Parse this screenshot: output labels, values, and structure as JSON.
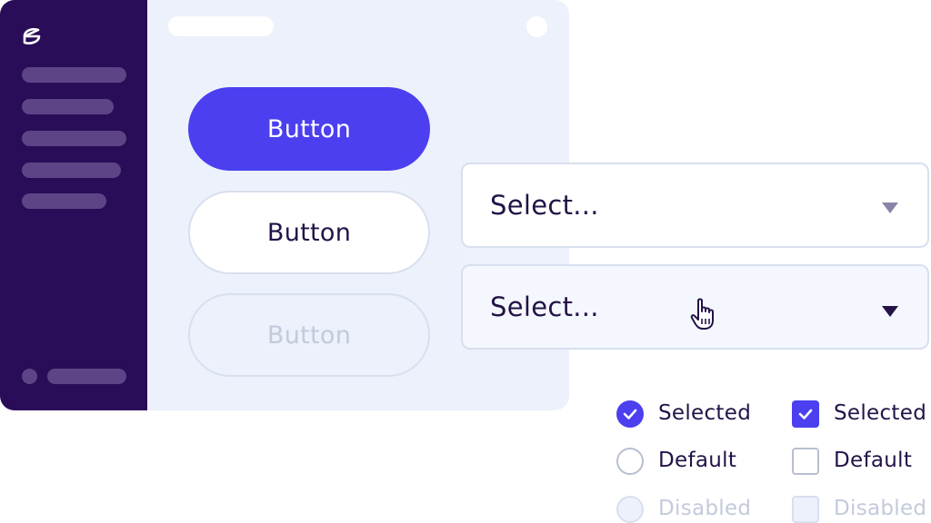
{
  "buttons": {
    "primary_label": "Button",
    "secondary_label": "Button",
    "disabled_label": "Button"
  },
  "selects": [
    {
      "placeholder": "Select...",
      "state": "default",
      "caret_icon": "chevron-down-icon"
    },
    {
      "placeholder": "Select...",
      "state": "hover",
      "caret_icon": "chevron-down-icon"
    }
  ],
  "radios": [
    {
      "label": "Selected",
      "state": "selected"
    },
    {
      "label": "Default",
      "state": "default"
    },
    {
      "label": "Disabled",
      "state": "disabled"
    }
  ],
  "checkboxes": [
    {
      "label": "Selected",
      "state": "selected"
    },
    {
      "label": "Default",
      "state": "default"
    },
    {
      "label": "Disabled",
      "state": "disabled"
    }
  ],
  "colors": {
    "accent": "#4b3ff0",
    "sidebar": "#2a0d58",
    "text": "#231347",
    "disabled_text": "#c3cadc",
    "surface": "#ecf1fb"
  },
  "icons": {
    "logo": "brand-logo-icon",
    "cursor": "hand-pointer-icon",
    "check": "check-icon"
  }
}
